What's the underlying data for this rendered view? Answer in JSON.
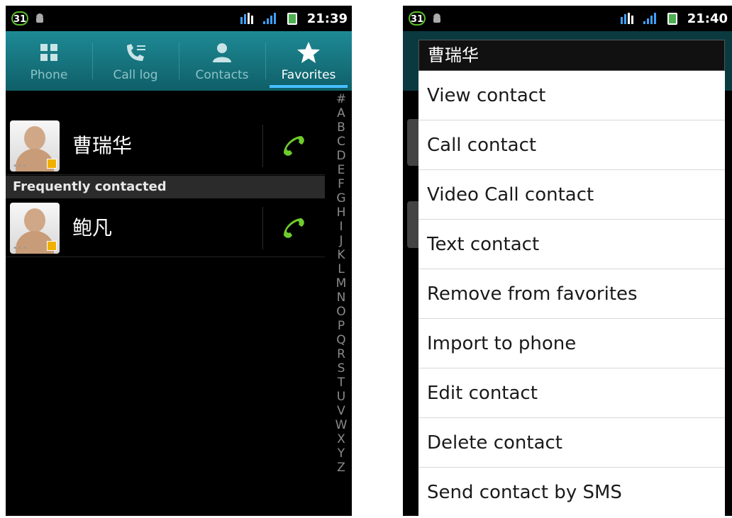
{
  "left": {
    "status": {
      "badge": "31",
      "time": "21:39"
    },
    "tabs": [
      {
        "label": "Phone",
        "icon": "dialpad-icon",
        "active": false
      },
      {
        "label": "Call log",
        "icon": "call-log-icon",
        "active": false
      },
      {
        "label": "Contacts",
        "icon": "contact-person-icon",
        "active": false
      },
      {
        "label": "Favorites",
        "icon": "star-icon",
        "active": true
      }
    ],
    "favorites": [
      {
        "name": "曹瑞华"
      }
    ],
    "section_header": "Frequently contacted",
    "frequent": [
      {
        "name": "鲍凡"
      }
    ],
    "alpha_index": [
      "#",
      "A",
      "B",
      "C",
      "D",
      "E",
      "F",
      "G",
      "H",
      "I",
      "J",
      "K",
      "L",
      "M",
      "N",
      "O",
      "P",
      "Q",
      "R",
      "S",
      "T",
      "U",
      "V",
      "W",
      "X",
      "Y",
      "Z"
    ]
  },
  "right": {
    "status": {
      "badge": "31",
      "time": "21:40"
    },
    "menu": {
      "title": "曹瑞华",
      "items": [
        "View contact",
        "Call contact",
        "Video Call contact",
        "Text contact",
        "Remove from favorites",
        "Import to phone",
        "Edit contact",
        "Delete contact",
        "Send contact by SMS"
      ]
    }
  },
  "colors": {
    "tab_bar": "#1e8a95",
    "tab_underline": "#46c0ff",
    "call_green": "#6ecb2c",
    "section_header_bg": "#2b2b2b"
  }
}
